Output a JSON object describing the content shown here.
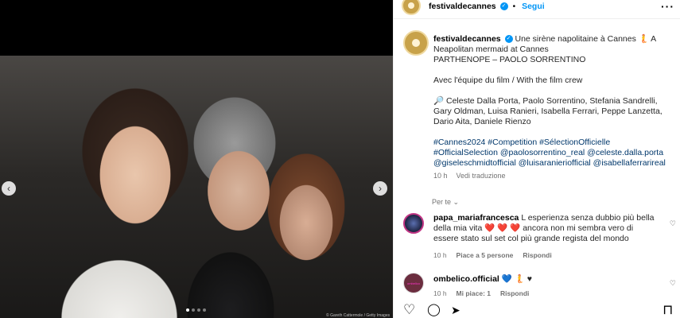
{
  "media": {
    "prev_icon": "chevron-left-icon",
    "next_icon": "chevron-right-icon",
    "prev_glyph": "‹",
    "next_glyph": "›",
    "slide_count": 4,
    "active_slide": 1,
    "credit": "© Gareth Cattermole / Getty Images"
  },
  "header": {
    "username": "festivaldecannes",
    "verified_glyph": "✓",
    "separator": "•",
    "follow_label": "Segui",
    "more_glyph": "···"
  },
  "caption": {
    "username": "festivaldecannes",
    "line1": "Une sirène napolitaine à Cannes 🧜 A Neapolitan mermaid at Cannes",
    "line2": "PARTHENOPE – PAOLO SORRENTINO",
    "line3": "Avec l'équipe du film / With the film crew",
    "cast": "🔎 Celeste Dalla Porta, Paolo Sorrentino, Stefania Sandrelli, Gary Oldman, Luisa Ranieri, Isabella Ferrari, Peppe Lanzetta, Dario Aita, Daniele Rienzo",
    "tags": "#Cannes2024 #Competition #SélectionOfficielle #OfficialSelection @paolosorrentino_real @celeste.dalla.porta @giseleschmidtofficial @luisaranieriofficial @isabellaferrarireal",
    "time": "10 h",
    "see_translation": "Vedi traduzione"
  },
  "by_you": "Per te ⌄",
  "comments": [
    {
      "username": "papa_mariafrancesca",
      "text_a": "L esperienza senza dubbio più bella della mia vita",
      "hearts": "❤️ ❤️ ❤️",
      "text_b": "ancora non mi sembra vero di essere stato sul set col più grande regista del mondo",
      "time": "10 h",
      "likes": "Piace a 5 persone",
      "reply": "Rispondi",
      "heart_glyph": "♡"
    },
    {
      "username": "ombelico.official",
      "emoji_a": "💙",
      "emoji_b": "🧜",
      "emoji_c": "♥",
      "time": "10 h",
      "likes": "Mi piace: 1",
      "reply": "Rispondi",
      "heart_glyph": "♡"
    }
  ],
  "actions": {
    "like_glyph": "♡",
    "comment_glyph": "◯",
    "share_glyph": "➤",
    "save_glyph": "⊓"
  },
  "colors": {
    "link": "#0095f6",
    "tag": "#00376b",
    "muted": "#737373"
  }
}
